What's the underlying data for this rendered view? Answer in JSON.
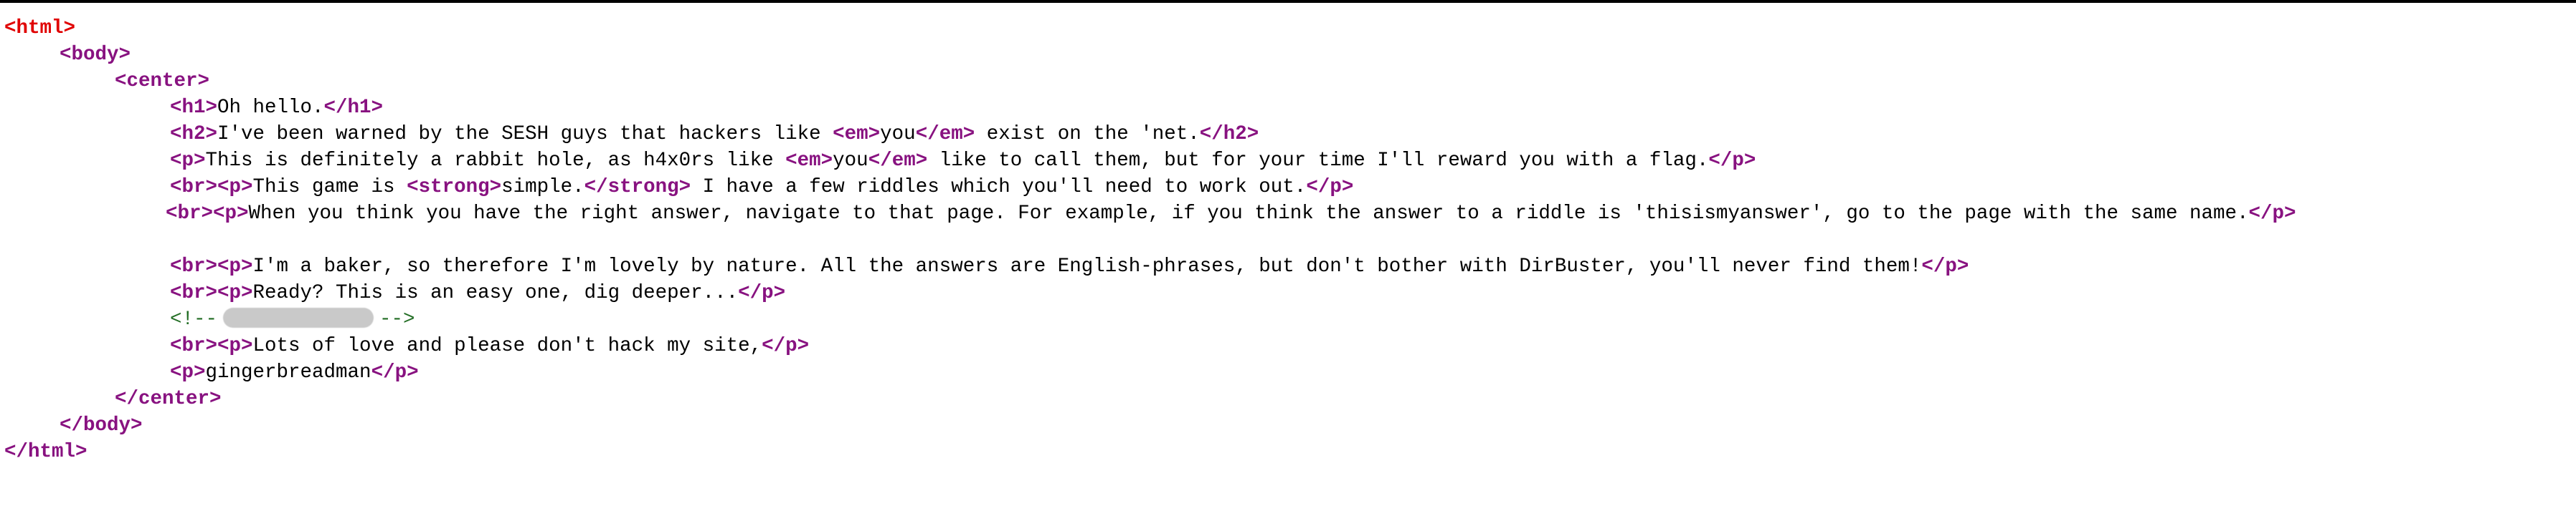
{
  "tags": {
    "html_open": "<html>",
    "body_open": "<body>",
    "center_open": "<center>",
    "center_close": "</center>",
    "body_close": "</body>",
    "html_close": "</html>",
    "br": "<br>",
    "p": "<p>",
    "p_close": "</p>",
    "h1": "<h1>",
    "h1_close": "</h1>",
    "h2": "<h2>",
    "h2_close": "</h2>",
    "em": "<em>",
    "em_close": "</em>",
    "strong": "<strong>",
    "strong_close": "</strong>",
    "comment_open": "<!--",
    "comment_close": "-->"
  },
  "text": {
    "h1": "Oh hello.",
    "h2_a": "I've been warned by the SESH guys that hackers like ",
    "h2_em": "you",
    "h2_b": " exist on the 'net.",
    "p1_a": "This is definitely a rabbit hole, as h4x0rs like ",
    "p1_em": "you",
    "p1_b": " like to call them, but for your time I'll reward you with a flag.",
    "p2_a": "This game is ",
    "p2_strong": "simple.",
    "p2_b": " I have a few riddles which you'll need to work out.",
    "p3": "When you think you have the right answer, navigate to that page. For example, if you think the answer to a riddle is 'thisismyanswer', go to the page with the same name.",
    "p4": "I'm a baker, so therefore I'm lovely by nature. All the answers are English-phrases, but don't bother with DirBuster, you'll never find them!",
    "p5": "Ready? This is an easy one, dig deeper...",
    "p6": "Lots of love and please don't hack my site,",
    "p7": "gingerbreadman"
  }
}
